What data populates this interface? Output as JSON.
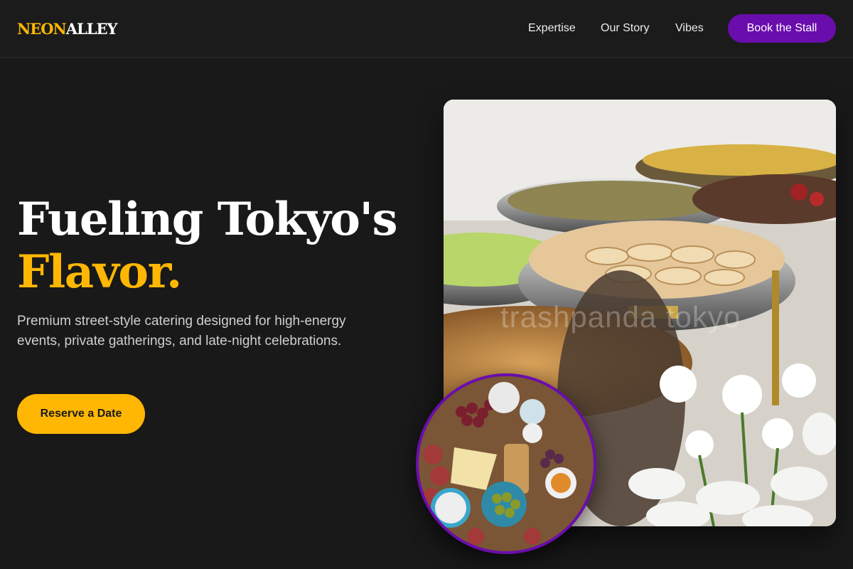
{
  "brand": {
    "logo_part1": "NEON",
    "logo_part2": "ALLEY"
  },
  "nav": {
    "items": [
      "Expertise",
      "Our Story",
      "Vibes"
    ],
    "cta": "Book the Stall"
  },
  "hero": {
    "title_line1": "Fueling Tokyo's",
    "title_line2": "Flavor.",
    "subtitle": "Premium street-style catering designed for high-energy events, private gatherings, and late-night celebrations.",
    "cta": "Reserve a Date"
  },
  "images": {
    "main": {
      "icon": "buffet-photo",
      "watermark": "trashpanda tokyo"
    },
    "inset": {
      "icon": "charcuterie-board-photo"
    }
  },
  "colors": {
    "background": "#191919",
    "accent_yellow": "#ffb703",
    "accent_purple": "#6a0dad",
    "text": "#ffffff",
    "muted_text": "#cfcfcf"
  }
}
